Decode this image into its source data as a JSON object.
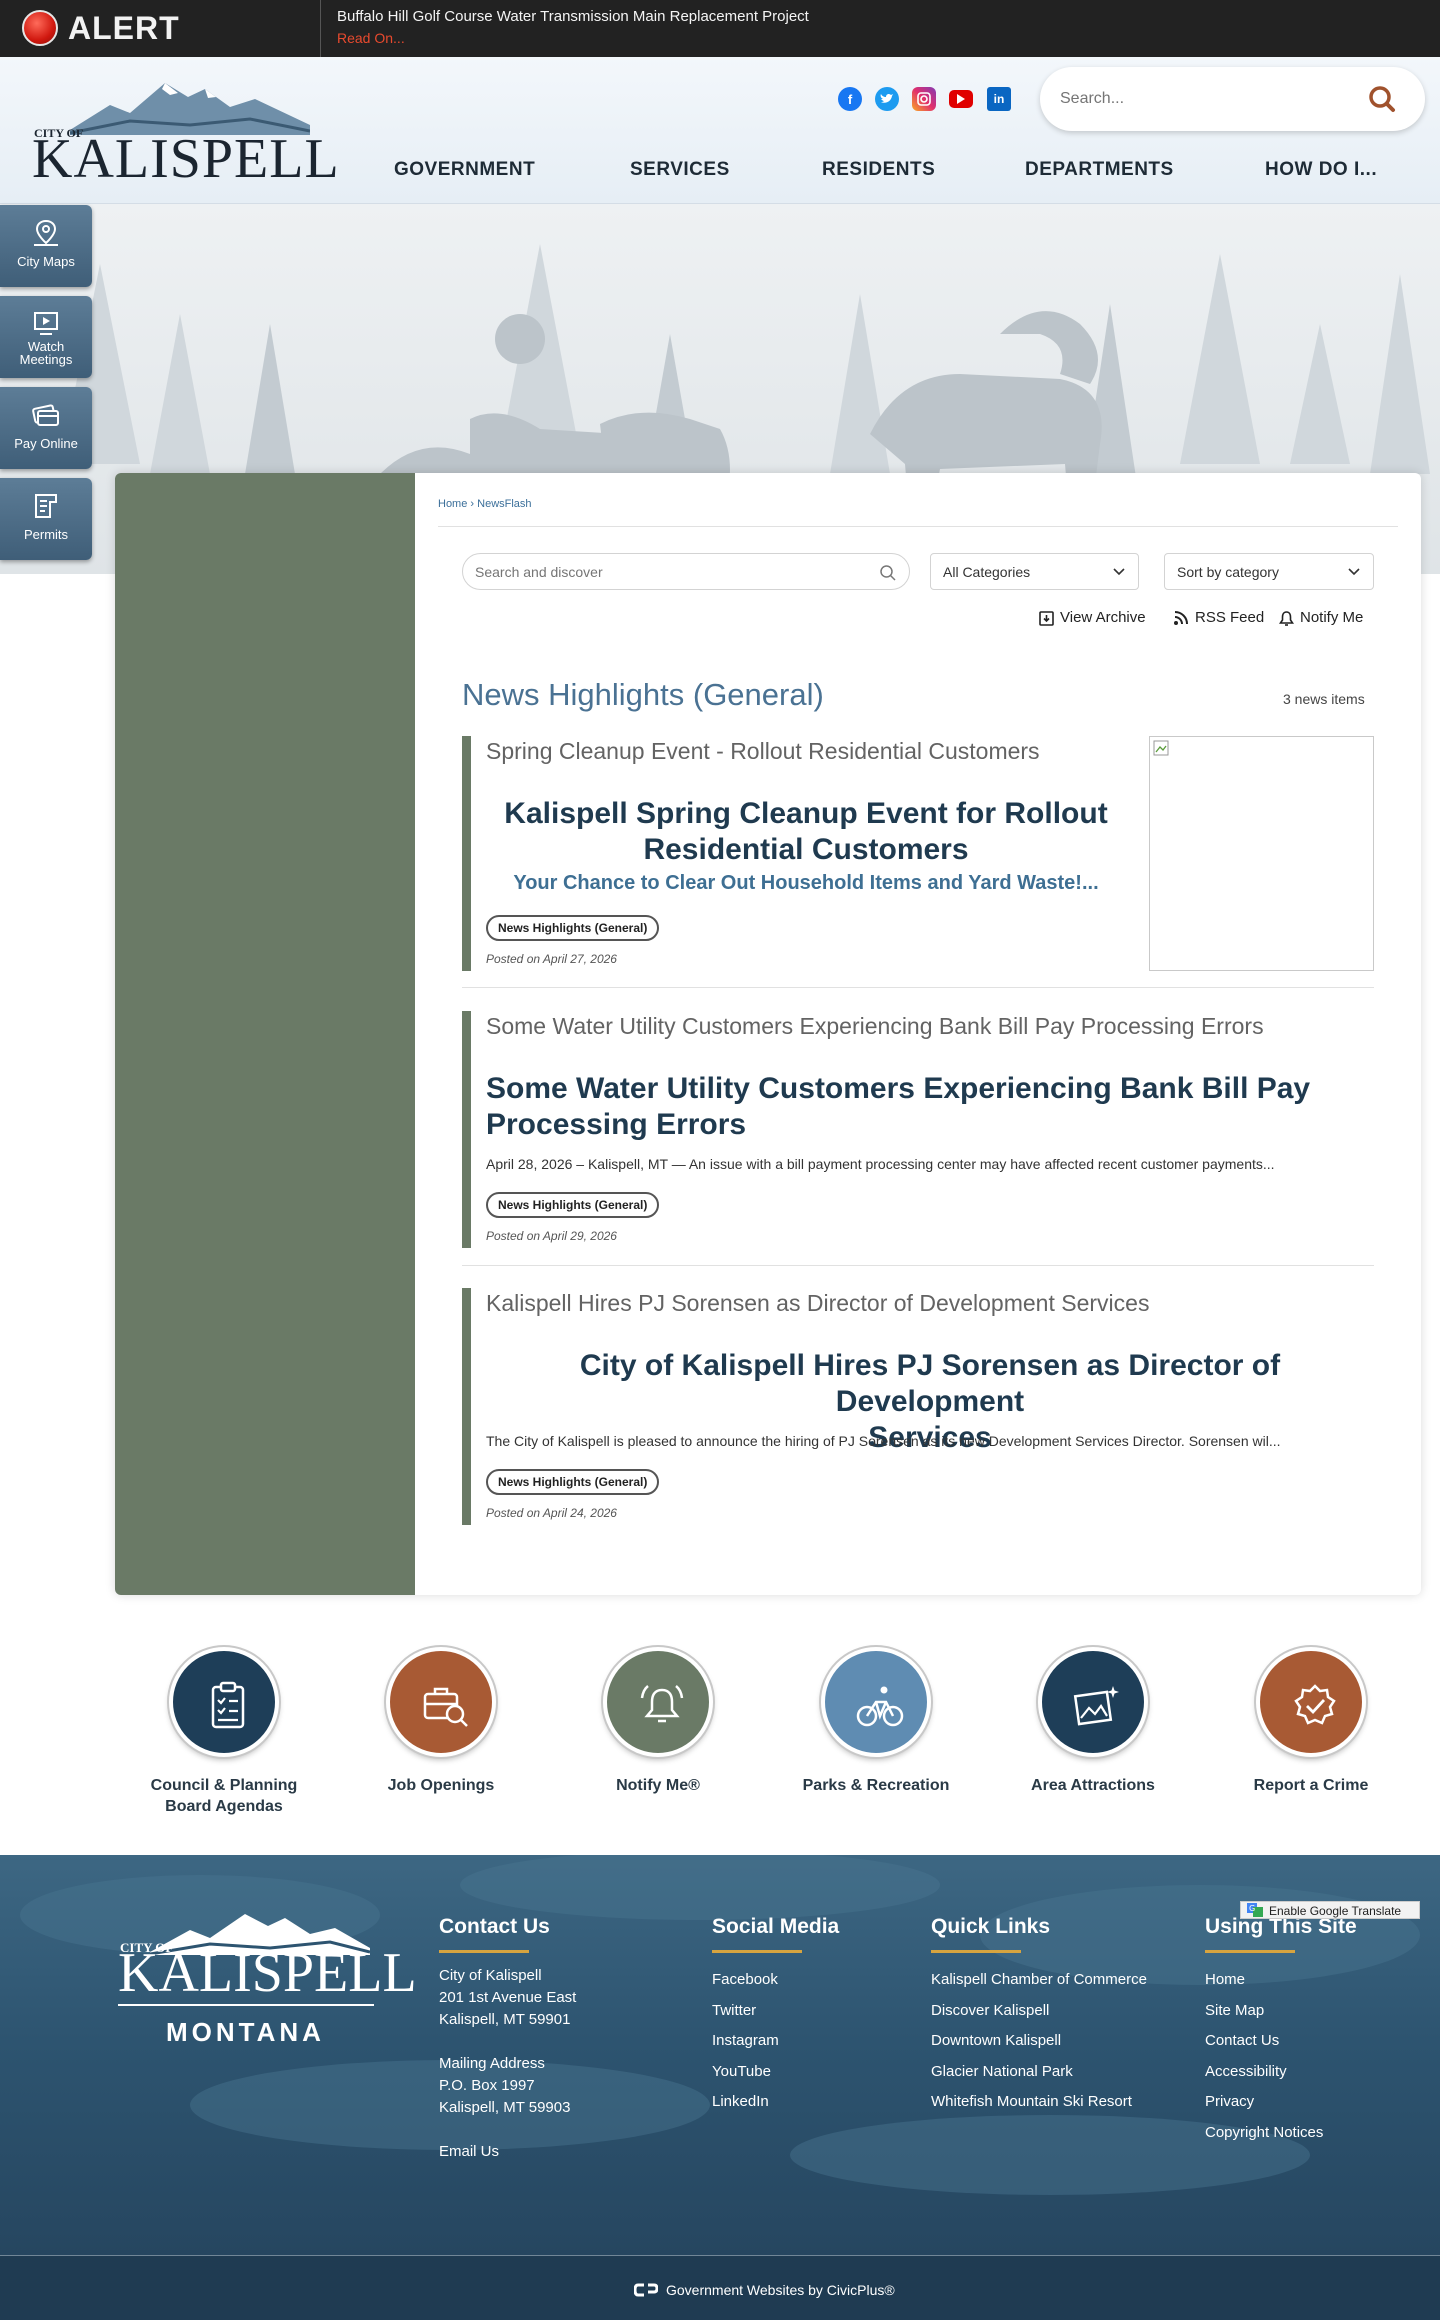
{
  "alert": {
    "label": "ALERT",
    "title": "Buffalo Hill Golf Course Water Transmission Main Replacement Project",
    "link": "Read On..."
  },
  "logo": {
    "city_of": "CITY OF",
    "name": "KALISPELL"
  },
  "social": [
    "facebook-icon",
    "twitter-icon",
    "instagram-icon",
    "youtube-icon",
    "linkedin-icon"
  ],
  "search": {
    "placeholder": "Search..."
  },
  "nav": [
    "GOVERNMENT",
    "SERVICES",
    "RESIDENTS",
    "DEPARTMENTS",
    "HOW DO I..."
  ],
  "side_buttons": [
    {
      "label1": "City Maps",
      "label2": ""
    },
    {
      "label1": "Watch",
      "label2": "Meetings"
    },
    {
      "label1": "Pay Online",
      "label2": ""
    },
    {
      "label1": "Permits",
      "label2": ""
    }
  ],
  "breadcrumb": {
    "home": "Home",
    "sep": "›",
    "current": "NewsFlash"
  },
  "news_filters": {
    "search_placeholder": "Search and discover",
    "category": "All Categories",
    "sort": "Sort by category"
  },
  "tools": {
    "archive": "View Archive",
    "rss": "RSS Feed",
    "notify": "Notify Me"
  },
  "section": {
    "title": "News Highlights (General)",
    "count": "3 news items"
  },
  "news": [
    {
      "heading": "Spring Cleanup Event - Rollout Residential Customers",
      "title_line1": "Kalispell Spring Cleanup Event for Rollout",
      "title_line2": "Residential Customers",
      "subtitle": "Your Chance to Clear Out Household Items and Yard Waste!...",
      "tag": "News Highlights (General)",
      "posted": "Posted on April 27, 2026"
    },
    {
      "heading": "Some Water Utility Customers Experiencing Bank Bill Pay Processing Errors",
      "title_line1": "Some Water Utility Customers Experiencing Bank Bill Pay",
      "title_line2": "Processing Errors",
      "body": "April 28, 2026 – Kalispell, MT — An issue with a bill payment processing center may have affected recent customer payments...",
      "tag": "News Highlights (General)",
      "posted": "Posted on April 29, 2026"
    },
    {
      "heading": "Kalispell Hires PJ Sorensen as Director of Development Services",
      "title_line1": "City of Kalispell Hires PJ Sorensen as Director of Development",
      "title_line2": "Services",
      "body": "The City of Kalispell is pleased to announce the hiring of PJ Sorensen as its new Development Services Director. Sorensen wil...",
      "tag": "News Highlights (General)",
      "posted": "Posted on April 24, 2026"
    }
  ],
  "quick_links": [
    {
      "line1": "Council & Planning",
      "line2": "Board Agendas",
      "color": "#1e3e58"
    },
    {
      "line1": "Job Openings",
      "line2": "",
      "color": "#a85a34"
    },
    {
      "line1": "Notify Me®",
      "line2": "",
      "color": "#6a7a66"
    },
    {
      "line1": "Parks & Recreation",
      "line2": "",
      "color": "#5f8cb2"
    },
    {
      "line1": "Area Attractions",
      "line2": "",
      "color": "#1e3e58"
    },
    {
      "line1": "Report a Crime",
      "line2": "",
      "color": "#a85a34"
    }
  ],
  "footer": {
    "logo_city": "CITY OF",
    "logo_name": "KALISPELL",
    "logo_state": "MONTANA",
    "contact": {
      "title": "Contact Us",
      "lines": [
        "City of Kalispell",
        "201 1st Avenue East",
        "Kalispell, MT 59901",
        "",
        "Mailing Address",
        "P.O. Box 1997",
        "Kalispell, MT 59903",
        "",
        "Email Us"
      ]
    },
    "social": {
      "title": "Social Media",
      "links": [
        "Facebook",
        "Twitter",
        "Instagram",
        "YouTube",
        "LinkedIn"
      ]
    },
    "quick": {
      "title": "Quick Links",
      "links": [
        "Kalispell Chamber of Commerce",
        "Discover Kalispell",
        "Downtown Kalispell",
        "Glacier National Park",
        "Whitefish Mountain Ski Resort"
      ]
    },
    "site": {
      "title": "Using This Site",
      "links": [
        "Home",
        "Site Map",
        "Contact Us",
        "Accessibility",
        "Privacy",
        "Copyright Notices"
      ]
    },
    "civicplus": "Government Websites by CivicPlus®",
    "translate": "Enable Google Translate"
  },
  "colors": {
    "accent": "#4a7293",
    "sidebar_green": "#6a7a66",
    "footer_gold": "#d7a43f",
    "alert_red": "#e84a2e"
  }
}
